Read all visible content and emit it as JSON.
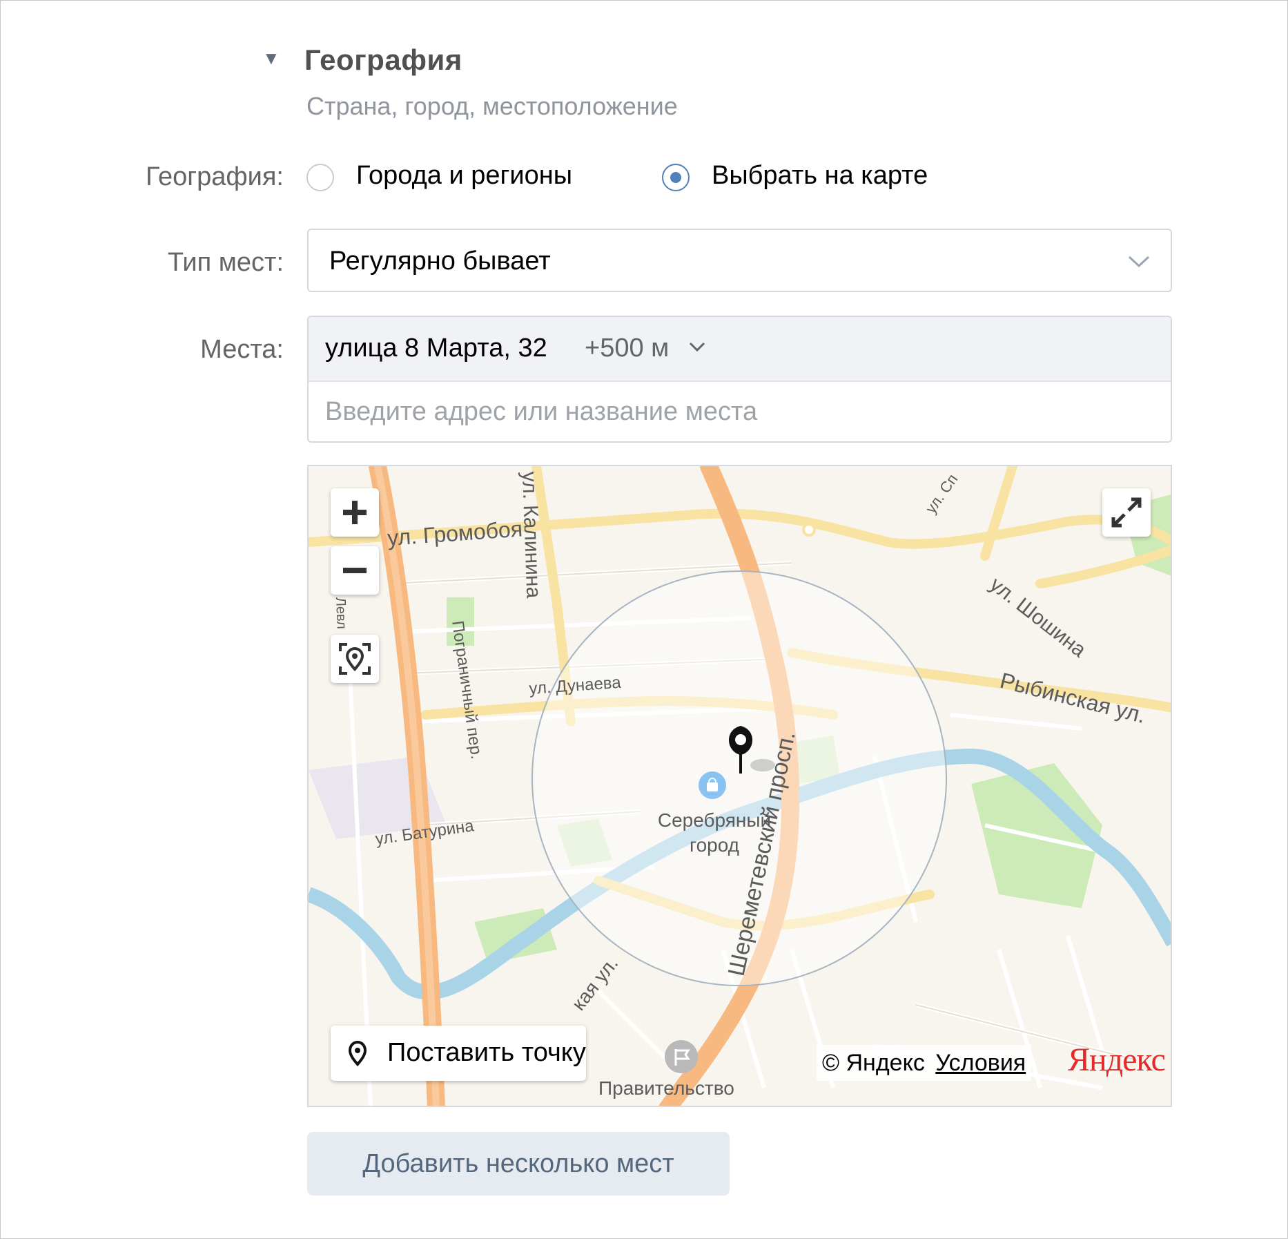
{
  "section": {
    "title": "География",
    "subtitle": "Страна, город, местоположение"
  },
  "geography": {
    "label": "География:",
    "options": [
      {
        "label": "Города и регионы",
        "selected": false
      },
      {
        "label": "Выбрать на карте",
        "selected": true
      }
    ]
  },
  "place_type": {
    "label": "Тип мест:",
    "value": "Регулярно бывает"
  },
  "places": {
    "label": "Места:",
    "items": [
      {
        "address": "улица 8 Марта, 32",
        "radius": "+500 м"
      }
    ],
    "input_placeholder": "Введите адрес или название места"
  },
  "map": {
    "streets": {
      "gromoboya": "ул. Громобоя",
      "kalinina": "ул. Калинина",
      "pogranichny": "Пограничный пер.",
      "dunaeva": "ул. Дунаева",
      "baturina": "ул. Батурина",
      "sheremetevsky": "Шереметевский просп.",
      "shoshina": "ул. Шошина",
      "rybinskaya": "Рыбинская ул.",
      "sp": "ул. Сп",
      "lev": "Левл",
      "kaya": "кая ул.",
      "pravitelstvo": "Правительство"
    },
    "poi": {
      "line1": "Серебряный",
      "line2": "город"
    },
    "place_point_label": "Поставить точку",
    "copyright": "© Яндекс",
    "terms_link": "Условия",
    "logo": "Яндекс"
  },
  "add_places_button": "Добавить несколько мест",
  "colors": {
    "accent": "#5181b8",
    "road_major": "#f7b97f",
    "road_minor": "#f9e3a2",
    "water": "#a9d4e8",
    "park": "#cdeab9"
  }
}
